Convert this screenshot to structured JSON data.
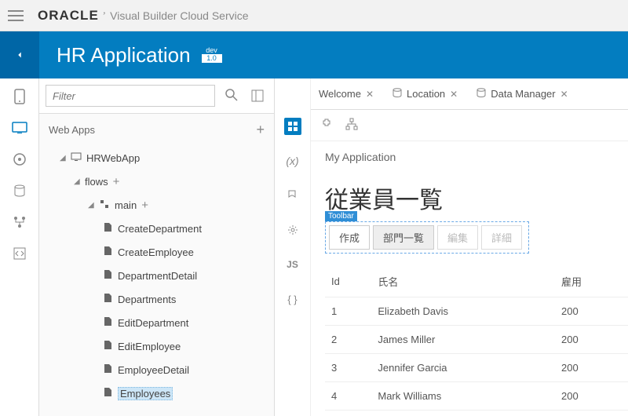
{
  "brand": {
    "oracle": "ORACLE",
    "sub": "'",
    "product": "Visual Builder Cloud Service"
  },
  "app": {
    "title": "HR Application",
    "version_tag": "dev",
    "version_num": "1.0"
  },
  "filter": {
    "placeholder": "Filter"
  },
  "section_title": "Web Apps",
  "tree": {
    "root": "HRWebApp",
    "flows_label": "flows",
    "main_label": "main",
    "pages": [
      "CreateDepartment",
      "CreateEmployee",
      "DepartmentDetail",
      "Departments",
      "EditDepartment",
      "EditEmployee",
      "EmployeeDetail",
      "Employees"
    ],
    "selected": "Employees"
  },
  "tabs": [
    {
      "label": "Welcome",
      "icon": null
    },
    {
      "label": "Location",
      "icon": "db"
    },
    {
      "label": "Data Manager",
      "icon": "db"
    }
  ],
  "editor": {
    "subtitle": "My Application",
    "page_heading": "従業員一覧",
    "toolbar_label": "Toolbar",
    "buttons": [
      {
        "label": "作成",
        "style": "normal"
      },
      {
        "label": "部門一覧",
        "style": "gray"
      },
      {
        "label": "編集",
        "style": "disabled"
      },
      {
        "label": "詳細",
        "style": "disabled"
      }
    ],
    "columns": [
      "Id",
      "氏名",
      "雇用"
    ],
    "rows": [
      {
        "id": "1",
        "name": "Elizabeth Davis",
        "col3": "200"
      },
      {
        "id": "2",
        "name": "James Miller",
        "col3": "200"
      },
      {
        "id": "3",
        "name": "Jennifer Garcia",
        "col3": "200"
      },
      {
        "id": "4",
        "name": "Mark Williams",
        "col3": "200"
      }
    ]
  }
}
